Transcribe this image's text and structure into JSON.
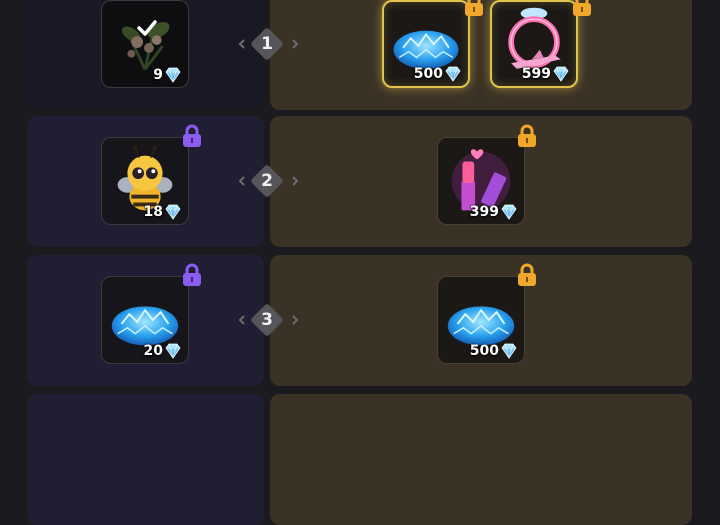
{
  "colors": {
    "background": "#1b1a1e",
    "free_panel": "#1f1e33",
    "premium_panel": "#3b3226",
    "free_lock": "#8a5cf0",
    "premium_lock": "#f0a72a",
    "highlight_border": "#e0c34c"
  },
  "rows": [
    {
      "level": "1",
      "free": {
        "item": "flower-bouquet",
        "price": "9",
        "claimed": true,
        "locked": false
      },
      "premium": [
        {
          "item": "gem-pile",
          "price": "500",
          "highlighted": true
        },
        {
          "item": "ring-and-plane",
          "price": "599",
          "highlighted": true
        }
      ]
    },
    {
      "level": "2",
      "free": {
        "item": "bee",
        "price": "18",
        "claimed": false,
        "locked": true
      },
      "premium": [
        {
          "item": "lipstick-gift",
          "price": "399",
          "highlighted": false
        }
      ]
    },
    {
      "level": "3",
      "free": {
        "item": "gem-pile",
        "price": "20",
        "claimed": false,
        "locked": true
      },
      "premium": [
        {
          "item": "gem-pile",
          "price": "500",
          "highlighted": false
        }
      ]
    }
  ]
}
